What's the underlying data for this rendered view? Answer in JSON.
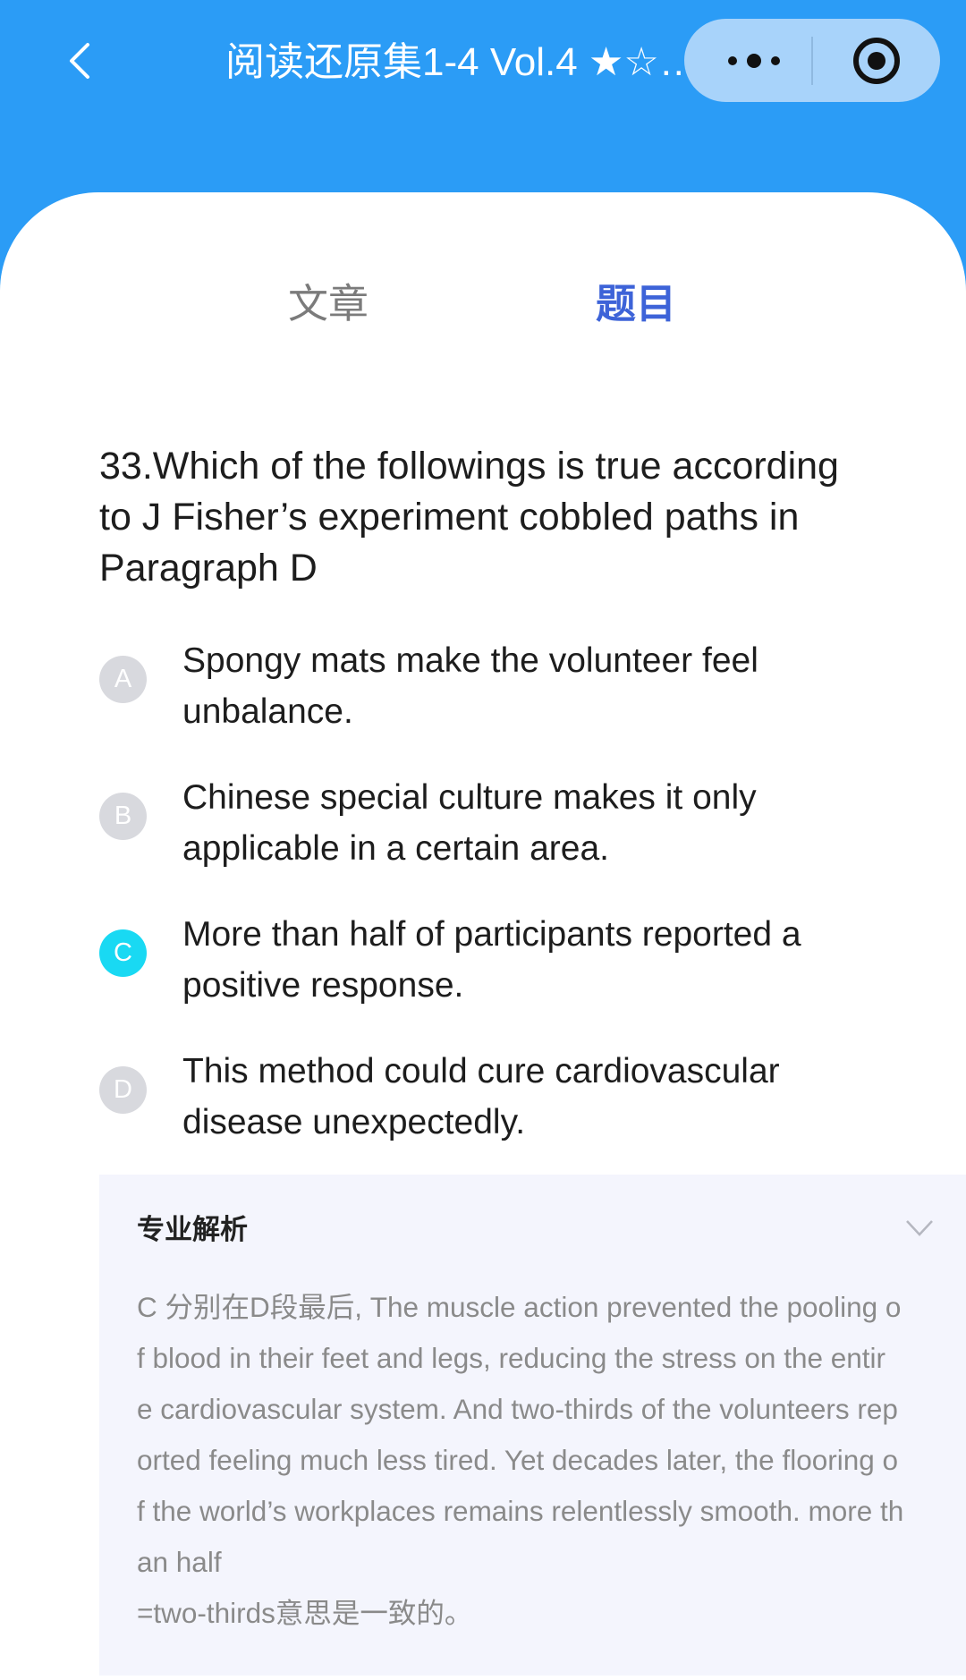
{
  "header": {
    "title": "阅读还原集1-4 Vol.4 ★☆…",
    "back_icon": "chevron-left-icon",
    "more_icon": "more-dots-icon",
    "target_icon": "target-icon",
    "color": "#2b9cf6"
  },
  "tabs": [
    {
      "label": "文章",
      "active": false
    },
    {
      "label": "题目",
      "active": true
    }
  ],
  "question": {
    "text": "33.Which of the followings is true according to J Fisher’s experiment cobbled paths in Paragraph D"
  },
  "options": [
    {
      "letter": "A",
      "text": "Spongy mats make the volunteer feel unbalance.",
      "selected": false
    },
    {
      "letter": "B",
      "text": "Chinese special culture makes it only applicable in a certain area.",
      "selected": false
    },
    {
      "letter": "C",
      "text": "More than half of participants reported a positive response.",
      "selected": true
    },
    {
      "letter": "D",
      "text": "This method could cure cardiovascular disease unexpectedly.",
      "selected": false
    }
  ],
  "analysis": {
    "title": "专业解析",
    "lines": [
      "C 分别在D段最后, The muscle action prevented the pooling o",
      "f blood in their feet and legs, reducing the stress on the entir",
      "e cardiovascular system. And two-thirds of the volunteers rep",
      "orted feeling much less tired. Yet decades later, the flooring o",
      "f the world’s workplaces remains relentlessly smooth. more th",
      "an half",
      "=two-thirds意思是一致的。"
    ]
  },
  "colors": {
    "active_tab": "#3d63d8",
    "selected_option": "#19d9f3",
    "option_default": "#d8d9de"
  }
}
